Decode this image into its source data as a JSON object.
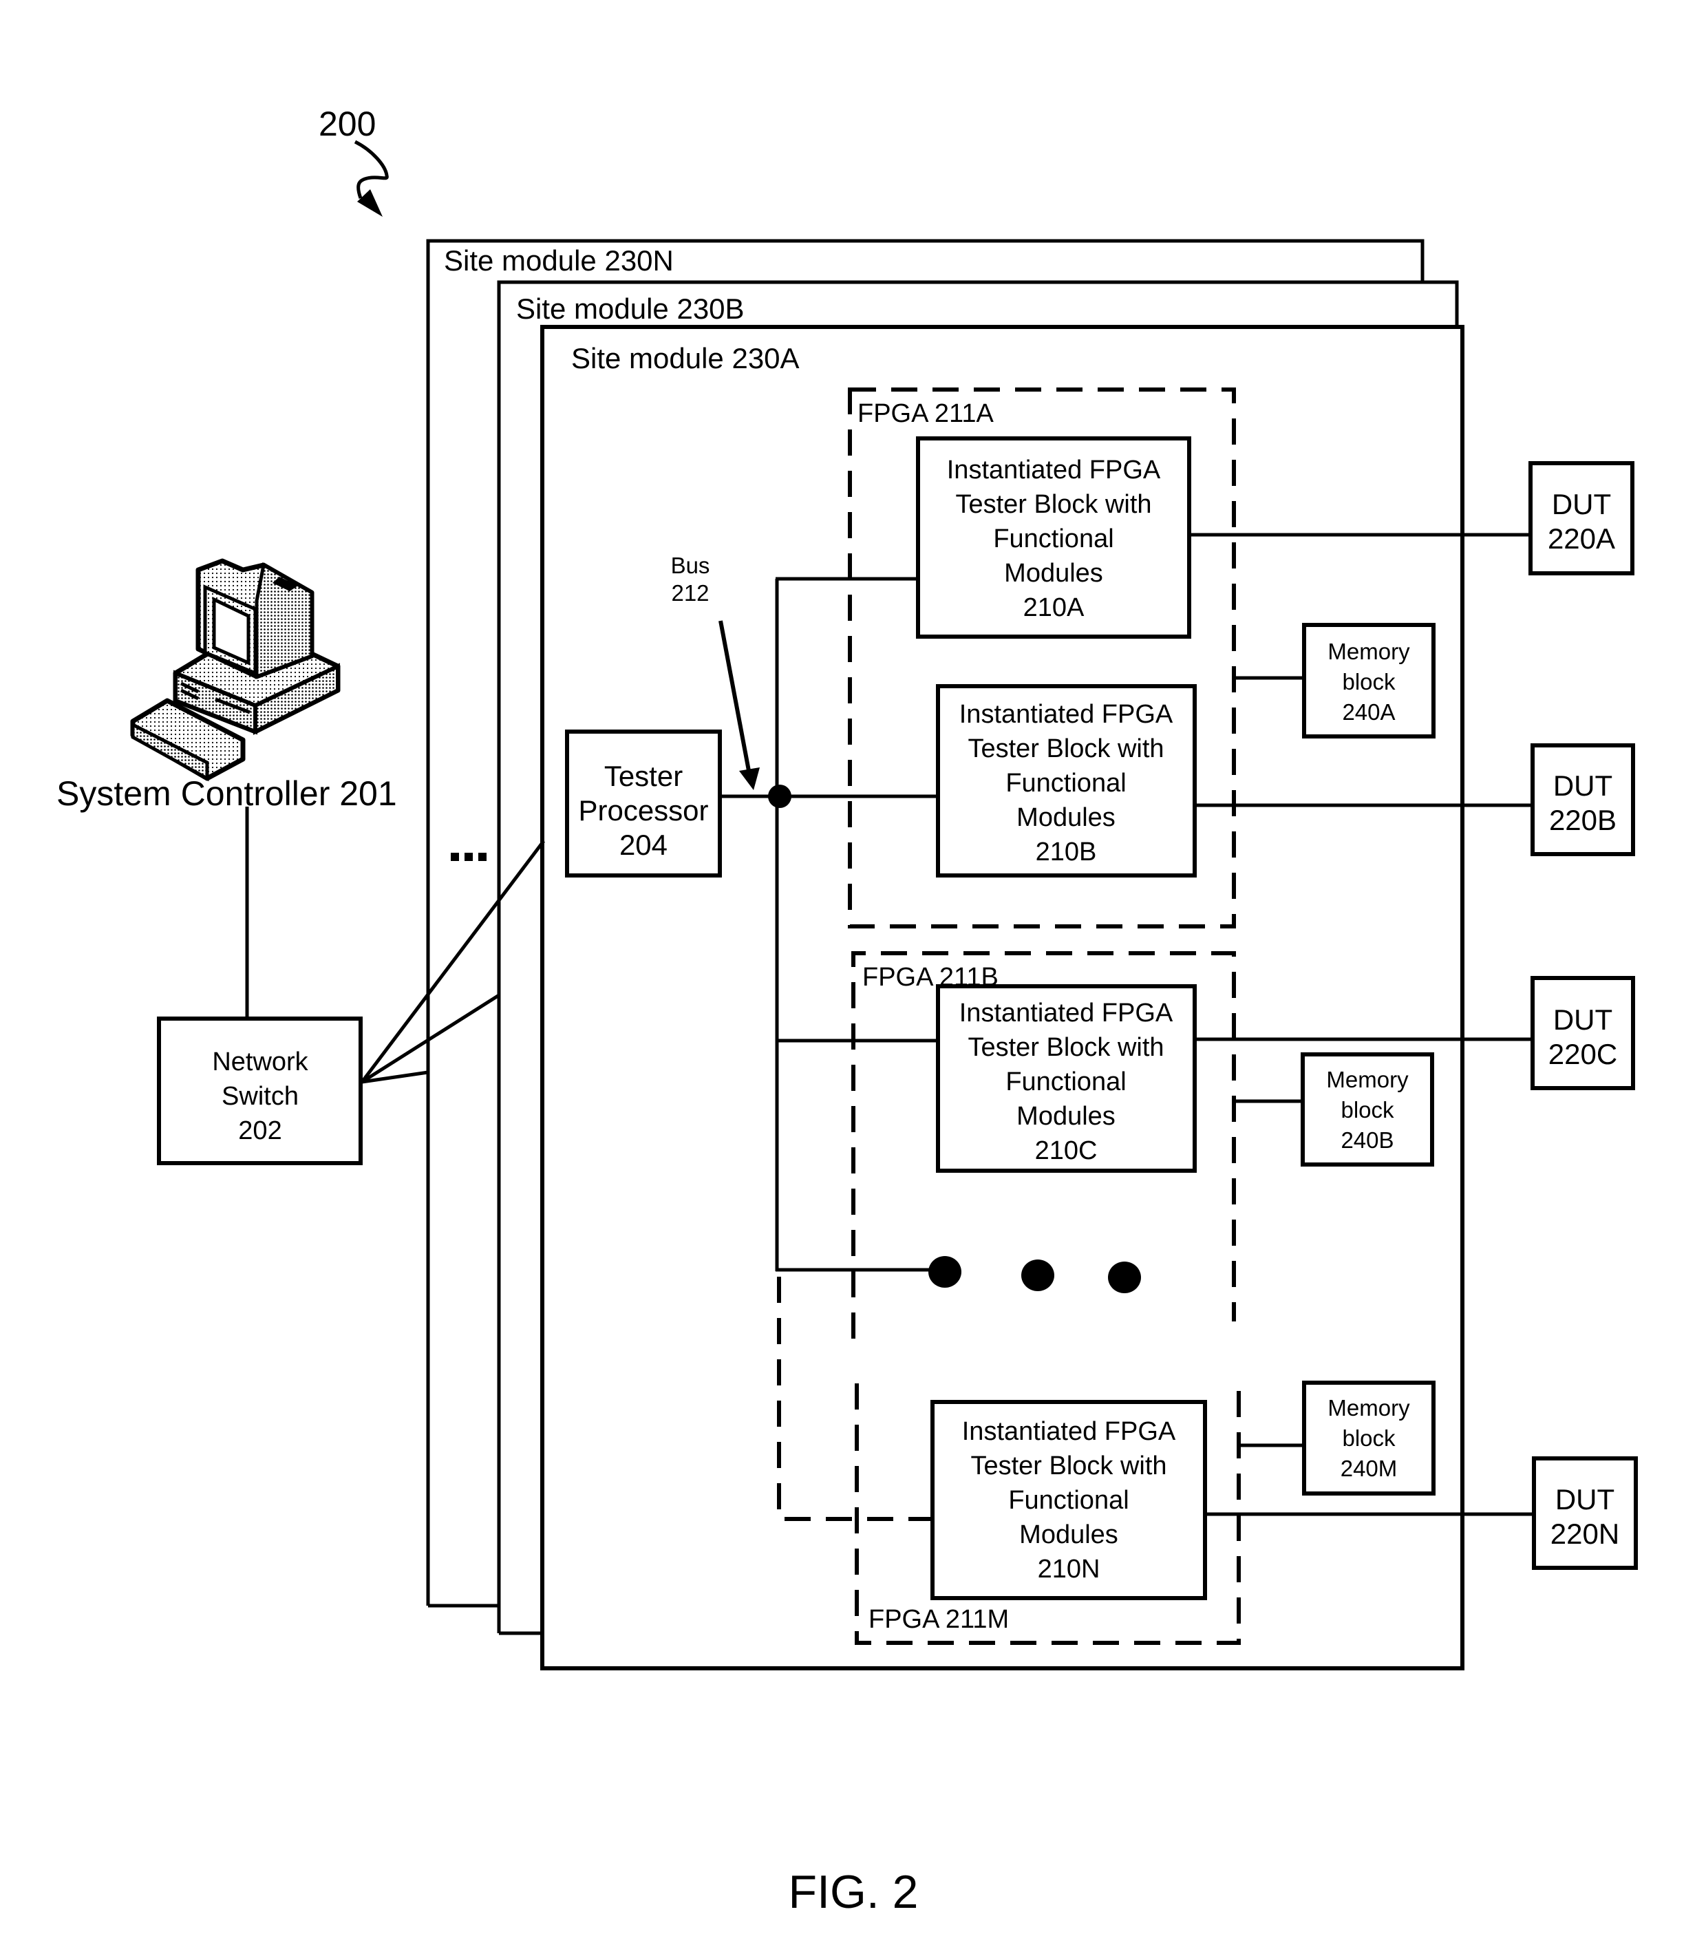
{
  "figure": {
    "reference_numeral": "200",
    "caption": "FIG. 2"
  },
  "system_controller": {
    "label": "System Controller 201",
    "icon": "desktop-computer-icon"
  },
  "network_switch": {
    "lines": [
      "Network",
      "Switch",
      "202"
    ]
  },
  "site_modules": [
    {
      "id": "230N",
      "label": "Site module 230N"
    },
    {
      "id": "230B",
      "label": "Site module 230B"
    },
    {
      "id": "230A",
      "label": "Site module 230A"
    }
  ],
  "site_module_ellipsis": "...",
  "tester_processor": {
    "lines": [
      "Tester",
      "Processor",
      "204"
    ]
  },
  "bus": {
    "lines": [
      "Bus",
      "212"
    ]
  },
  "fpgas": [
    {
      "id": "211A",
      "label": "FPGA 211A"
    },
    {
      "id": "211B",
      "label": "FPGA 211B"
    },
    {
      "id": "211M",
      "label": "FPGA 211M"
    }
  ],
  "tester_blocks": [
    {
      "id": "210A",
      "lines": [
        "Instantiated FPGA",
        "Tester Block with",
        "Functional",
        "Modules",
        "210A"
      ]
    },
    {
      "id": "210B",
      "lines": [
        "Instantiated FPGA",
        "Tester Block with",
        "Functional",
        "Modules",
        "210B"
      ]
    },
    {
      "id": "210C",
      "lines": [
        "Instantiated FPGA",
        "Tester Block with",
        "Functional",
        "Modules",
        "210C"
      ]
    },
    {
      "id": "210N",
      "lines": [
        "Instantiated FPGA",
        "Tester Block with",
        "Functional",
        "Modules",
        "210N"
      ]
    }
  ],
  "memory_blocks": [
    {
      "id": "240A",
      "lines": [
        "Memory",
        "block",
        "240A"
      ]
    },
    {
      "id": "240B",
      "lines": [
        "Memory",
        "block",
        "240B"
      ]
    },
    {
      "id": "240M",
      "lines": [
        "Memory",
        "block",
        "240M"
      ]
    }
  ],
  "duts": [
    {
      "id": "220A",
      "lines": [
        "DUT",
        "220A"
      ]
    },
    {
      "id": "220B",
      "lines": [
        "DUT",
        "220B"
      ]
    },
    {
      "id": "220C",
      "lines": [
        "DUT",
        "220C"
      ]
    },
    {
      "id": "220N",
      "lines": [
        "DUT",
        "220N"
      ]
    }
  ]
}
